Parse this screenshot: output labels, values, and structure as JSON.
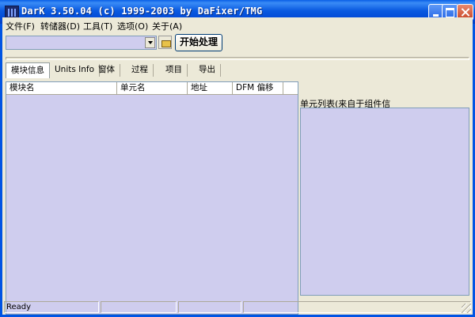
{
  "window": {
    "title": "DarK 3.50.04 (c) 1999-2003 by DaFixer/TMG"
  },
  "menu": [
    {
      "label": "文件(F)"
    },
    {
      "label": "转储器(D)"
    },
    {
      "label": "工具(T)"
    },
    {
      "label": "选项(O)"
    },
    {
      "label": "关于(A)"
    }
  ],
  "toolbar": {
    "path_value": "",
    "start_label": "开始处理"
  },
  "tabs": [
    {
      "label": "模块信息",
      "active": true
    },
    {
      "label": "Units Info",
      "active": false
    },
    {
      "label": "窗体",
      "active": false
    },
    {
      "label": "过程",
      "active": false
    },
    {
      "label": "项目",
      "active": false
    },
    {
      "label": "导出",
      "active": false
    }
  ],
  "table": {
    "columns": [
      "模块名",
      "单元名",
      "地址",
      "DFM 偏移"
    ],
    "rows": []
  },
  "right_panel": {
    "title": "单元列表(来自于组件信"
  },
  "status": {
    "text": "Ready",
    "panes": [
      "",
      "",
      ""
    ]
  }
}
